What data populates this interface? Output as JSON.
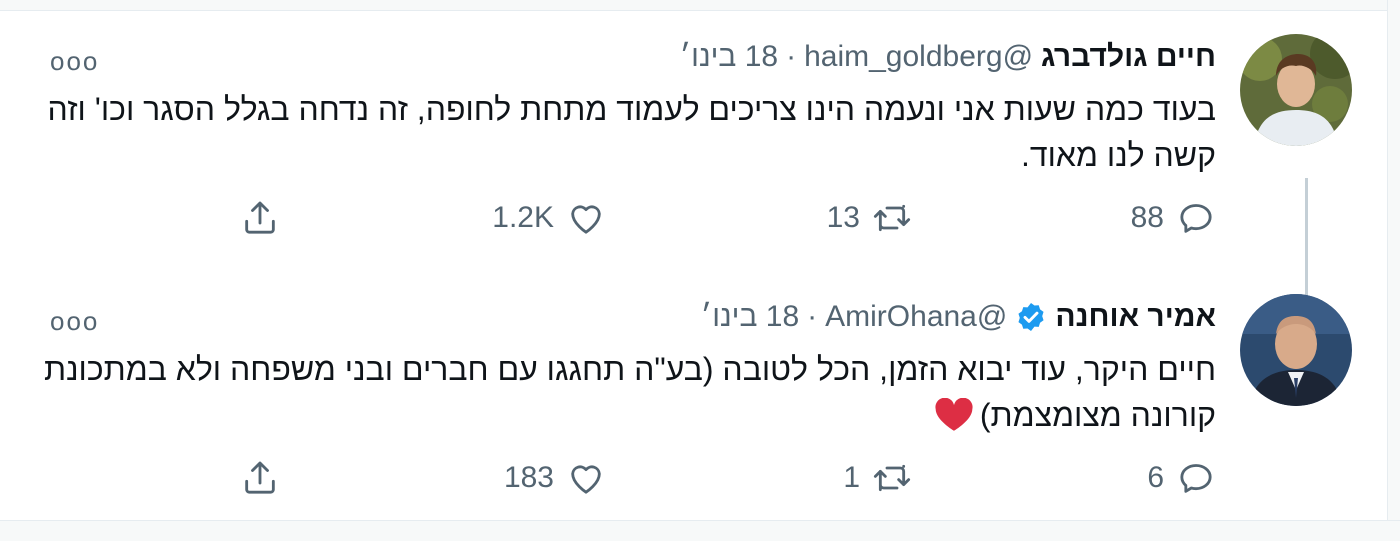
{
  "tweets": [
    {
      "name": "חיים גולדברג",
      "handle": "@haim_goldberg",
      "separator": "·",
      "date": "18 בינו׳",
      "verified": false,
      "more": "ooo",
      "text": "בעוד כמה שעות אני ונעמה הינו צריכים לעמוד מתחת לחופה, זה נדחה בגלל הסגר וכו' וזה קשה לנו מאוד.",
      "replies": "88",
      "retweets": "13",
      "likes": "1.2K"
    },
    {
      "name": "אמיר אוחנה",
      "handle": "@AmirOhana",
      "separator": "·",
      "date": "18 בינו׳",
      "verified": true,
      "more": "ooo",
      "text": "חיים היקר, עוד יבוא הזמן, הכל לטובה (בע\"ה תחגגו עם חברים ובני משפחה ולא במתכונת קורונה מצומצמת)",
      "replies": "6",
      "retweets": "1",
      "likes": "183"
    }
  ],
  "icons": {
    "reply": "reply-icon",
    "retweet": "retweet-icon",
    "like": "like-icon",
    "share": "share-icon",
    "verified": "verified-badge-icon",
    "emoji": "red-heart-emoji"
  },
  "colors": {
    "verified": "#1d9bf0",
    "muted": "#536471",
    "text": "#0f1419",
    "heart_emoji": "#dd2e44",
    "thread_line": "#c4cfd6"
  }
}
